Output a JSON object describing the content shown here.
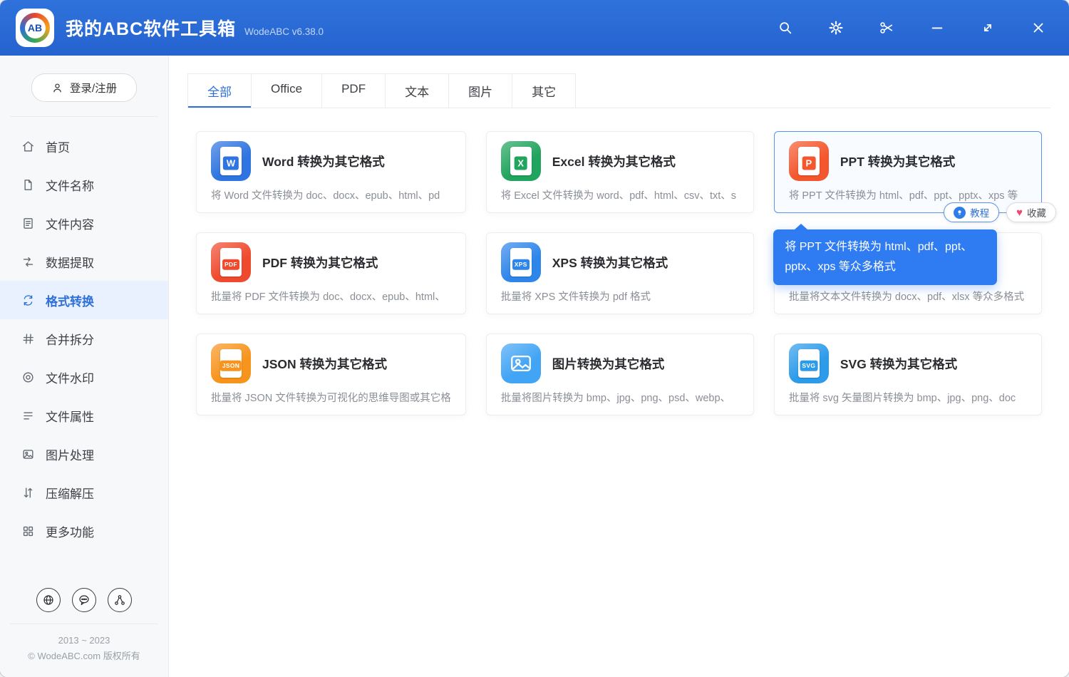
{
  "titlebar": {
    "logo_text": "AB",
    "app_title": "我的ABC软件工具箱",
    "version": "WodeABC v6.38.0"
  },
  "sidebar": {
    "login_label": "登录/注册",
    "items": [
      {
        "label": "首页",
        "active": false
      },
      {
        "label": "文件名称",
        "active": false
      },
      {
        "label": "文件内容",
        "active": false
      },
      {
        "label": "数据提取",
        "active": false
      },
      {
        "label": "格式转换",
        "active": true
      },
      {
        "label": "合并拆分",
        "active": false
      },
      {
        "label": "文件水印",
        "active": false
      },
      {
        "label": "文件属性",
        "active": false
      },
      {
        "label": "图片处理",
        "active": false
      },
      {
        "label": "压缩解压",
        "active": false
      },
      {
        "label": "更多功能",
        "active": false
      }
    ],
    "footer": {
      "years": "2013 ~ 2023",
      "copyright": "© WodeABC.com 版权所有"
    }
  },
  "tabs": [
    {
      "label": "全部",
      "active": true
    },
    {
      "label": "Office",
      "active": false
    },
    {
      "label": "PDF",
      "active": false
    },
    {
      "label": "文本",
      "active": false
    },
    {
      "label": "图片",
      "active": false
    },
    {
      "label": "其它",
      "active": false
    }
  ],
  "cards": [
    {
      "title": "Word 转换为其它格式",
      "desc": "将 Word 文件转换为 doc、docx、epub、html、pd",
      "icon_text": "W",
      "icon_color": "#2f74e0"
    },
    {
      "title": "Excel 转换为其它格式",
      "desc": "将 Excel 文件转换为 word、pdf、html、csv、txt、s",
      "icon_text": "X",
      "icon_color": "#21a45d"
    },
    {
      "title": "PPT 转换为其它格式",
      "desc": "将 PPT 文件转换为 html、pdf、ppt、pptx、xps 等",
      "icon_text": "P",
      "icon_color": "#f4572d",
      "hovered": true
    },
    {
      "title": "PDF 转换为其它格式",
      "desc": "批量将 PDF 文件转换为 doc、docx、epub、html、",
      "icon_text": "PDF",
      "icon_color": "#ef4a2e"
    },
    {
      "title": "XPS 转换为其它格式",
      "desc": "批量将 XPS 文件转换为 pdf 格式",
      "icon_text": "XPS",
      "icon_color": "#2f86ea"
    },
    {
      "title": "",
      "desc": "批量将文本文件转换为 docx、pdf、xlsx 等众多格式",
      "icon_text": "",
      "icon_color": "#9aa2ae",
      "covered_by_tooltip": true
    },
    {
      "title": "JSON 转换为其它格式",
      "desc": "批量将 JSON 文件转换为可视化的思维导图或其它格",
      "icon_text": "JSON",
      "icon_color": "#f7941d"
    },
    {
      "title": "图片转换为其它格式",
      "desc": "批量将图片转换为 bmp、jpg、png、psd、webp、",
      "icon_text": "",
      "icon_color": "#41a4f5"
    },
    {
      "title": "SVG 转换为其它格式",
      "desc": "批量将 svg 矢量图片转换为 bmp、jpg、png、doc",
      "icon_text": "SVG",
      "icon_color": "#2c9bea"
    }
  ],
  "hover_actions": {
    "tutorial": "教程",
    "favorite": "收藏"
  },
  "tooltip": {
    "text": "将 PPT 文件转换为 html、pdf、ppt、pptx、xps 等众多格式"
  },
  "colors": {
    "titlebar_bg": "#2a6bd5",
    "accent": "#2e6fd8",
    "active_item_bg": "#e8f1fd",
    "tooltip_bg": "#2e7bf2",
    "hover_border": "#5a95e8"
  }
}
